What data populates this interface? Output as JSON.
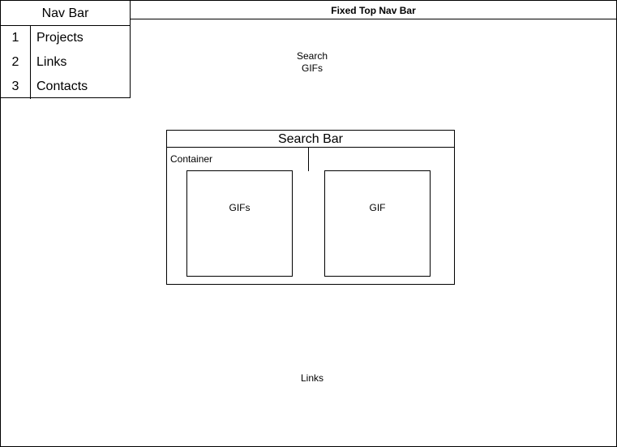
{
  "top_nav": {
    "label": "Fixed Top Nav Bar"
  },
  "nav_bar": {
    "title": "Nav Bar",
    "items": [
      {
        "number": "1",
        "label": "Projects"
      },
      {
        "number": "2",
        "label": "Links"
      },
      {
        "number": "3",
        "label": "Contacts"
      }
    ]
  },
  "search_gifs_label": "Search\nGIFs",
  "search_panel": {
    "title": "Search Bar",
    "container_label": "Container",
    "gifs_box_label": "GIFs",
    "gif_box_label": "GIF"
  },
  "links_label": "Links"
}
